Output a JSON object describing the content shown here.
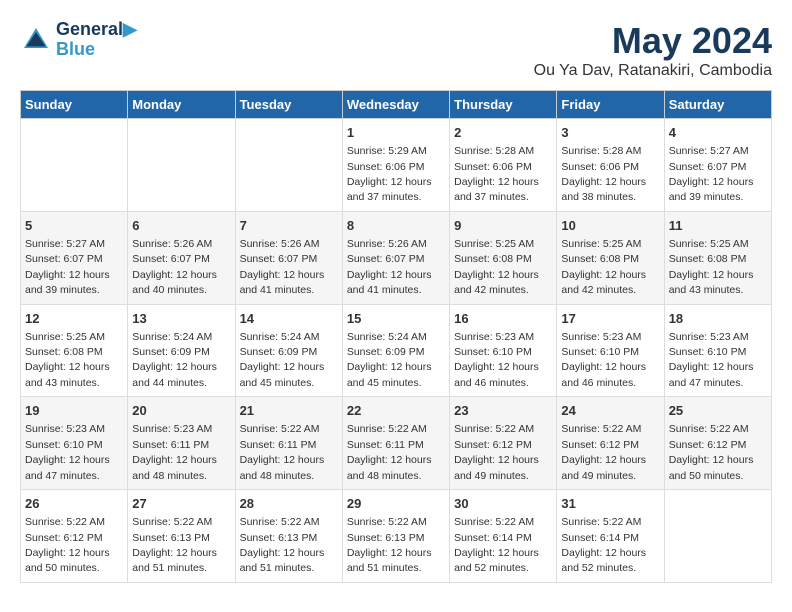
{
  "header": {
    "logo_line1": "General",
    "logo_line2": "Blue",
    "title": "May 2024",
    "subtitle": "Ou Ya Dav, Ratanakiri, Cambodia"
  },
  "days_of_week": [
    "Sunday",
    "Monday",
    "Tuesday",
    "Wednesday",
    "Thursday",
    "Friday",
    "Saturday"
  ],
  "weeks": [
    [
      {
        "day": "",
        "info": ""
      },
      {
        "day": "",
        "info": ""
      },
      {
        "day": "",
        "info": ""
      },
      {
        "day": "1",
        "info": "Sunrise: 5:29 AM\nSunset: 6:06 PM\nDaylight: 12 hours\nand 37 minutes."
      },
      {
        "day": "2",
        "info": "Sunrise: 5:28 AM\nSunset: 6:06 PM\nDaylight: 12 hours\nand 37 minutes."
      },
      {
        "day": "3",
        "info": "Sunrise: 5:28 AM\nSunset: 6:06 PM\nDaylight: 12 hours\nand 38 minutes."
      },
      {
        "day": "4",
        "info": "Sunrise: 5:27 AM\nSunset: 6:07 PM\nDaylight: 12 hours\nand 39 minutes."
      }
    ],
    [
      {
        "day": "5",
        "info": "Sunrise: 5:27 AM\nSunset: 6:07 PM\nDaylight: 12 hours\nand 39 minutes."
      },
      {
        "day": "6",
        "info": "Sunrise: 5:26 AM\nSunset: 6:07 PM\nDaylight: 12 hours\nand 40 minutes."
      },
      {
        "day": "7",
        "info": "Sunrise: 5:26 AM\nSunset: 6:07 PM\nDaylight: 12 hours\nand 41 minutes."
      },
      {
        "day": "8",
        "info": "Sunrise: 5:26 AM\nSunset: 6:07 PM\nDaylight: 12 hours\nand 41 minutes."
      },
      {
        "day": "9",
        "info": "Sunrise: 5:25 AM\nSunset: 6:08 PM\nDaylight: 12 hours\nand 42 minutes."
      },
      {
        "day": "10",
        "info": "Sunrise: 5:25 AM\nSunset: 6:08 PM\nDaylight: 12 hours\nand 42 minutes."
      },
      {
        "day": "11",
        "info": "Sunrise: 5:25 AM\nSunset: 6:08 PM\nDaylight: 12 hours\nand 43 minutes."
      }
    ],
    [
      {
        "day": "12",
        "info": "Sunrise: 5:25 AM\nSunset: 6:08 PM\nDaylight: 12 hours\nand 43 minutes."
      },
      {
        "day": "13",
        "info": "Sunrise: 5:24 AM\nSunset: 6:09 PM\nDaylight: 12 hours\nand 44 minutes."
      },
      {
        "day": "14",
        "info": "Sunrise: 5:24 AM\nSunset: 6:09 PM\nDaylight: 12 hours\nand 45 minutes."
      },
      {
        "day": "15",
        "info": "Sunrise: 5:24 AM\nSunset: 6:09 PM\nDaylight: 12 hours\nand 45 minutes."
      },
      {
        "day": "16",
        "info": "Sunrise: 5:23 AM\nSunset: 6:10 PM\nDaylight: 12 hours\nand 46 minutes."
      },
      {
        "day": "17",
        "info": "Sunrise: 5:23 AM\nSunset: 6:10 PM\nDaylight: 12 hours\nand 46 minutes."
      },
      {
        "day": "18",
        "info": "Sunrise: 5:23 AM\nSunset: 6:10 PM\nDaylight: 12 hours\nand 47 minutes."
      }
    ],
    [
      {
        "day": "19",
        "info": "Sunrise: 5:23 AM\nSunset: 6:10 PM\nDaylight: 12 hours\nand 47 minutes."
      },
      {
        "day": "20",
        "info": "Sunrise: 5:23 AM\nSunset: 6:11 PM\nDaylight: 12 hours\nand 48 minutes."
      },
      {
        "day": "21",
        "info": "Sunrise: 5:22 AM\nSunset: 6:11 PM\nDaylight: 12 hours\nand 48 minutes."
      },
      {
        "day": "22",
        "info": "Sunrise: 5:22 AM\nSunset: 6:11 PM\nDaylight: 12 hours\nand 48 minutes."
      },
      {
        "day": "23",
        "info": "Sunrise: 5:22 AM\nSunset: 6:12 PM\nDaylight: 12 hours\nand 49 minutes."
      },
      {
        "day": "24",
        "info": "Sunrise: 5:22 AM\nSunset: 6:12 PM\nDaylight: 12 hours\nand 49 minutes."
      },
      {
        "day": "25",
        "info": "Sunrise: 5:22 AM\nSunset: 6:12 PM\nDaylight: 12 hours\nand 50 minutes."
      }
    ],
    [
      {
        "day": "26",
        "info": "Sunrise: 5:22 AM\nSunset: 6:12 PM\nDaylight: 12 hours\nand 50 minutes."
      },
      {
        "day": "27",
        "info": "Sunrise: 5:22 AM\nSunset: 6:13 PM\nDaylight: 12 hours\nand 51 minutes."
      },
      {
        "day": "28",
        "info": "Sunrise: 5:22 AM\nSunset: 6:13 PM\nDaylight: 12 hours\nand 51 minutes."
      },
      {
        "day": "29",
        "info": "Sunrise: 5:22 AM\nSunset: 6:13 PM\nDaylight: 12 hours\nand 51 minutes."
      },
      {
        "day": "30",
        "info": "Sunrise: 5:22 AM\nSunset: 6:14 PM\nDaylight: 12 hours\nand 52 minutes."
      },
      {
        "day": "31",
        "info": "Sunrise: 5:22 AM\nSunset: 6:14 PM\nDaylight: 12 hours\nand 52 minutes."
      },
      {
        "day": "",
        "info": ""
      }
    ]
  ]
}
